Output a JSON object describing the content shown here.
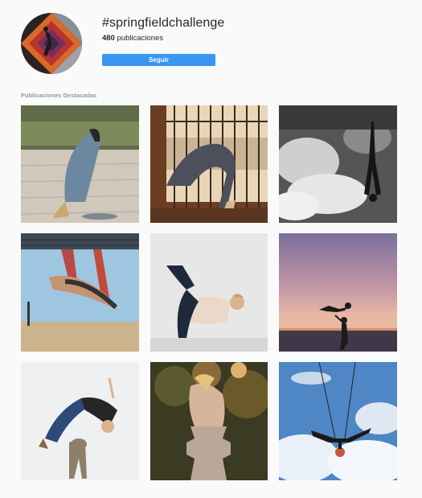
{
  "header": {
    "hashtag": "#springfieldchallenge",
    "post_count": "480",
    "post_count_suffix": " publicaciones",
    "follow_label": "Seguir"
  },
  "top_posts": {
    "label": "Publicaciones Destacadas"
  },
  "colors": {
    "accent": "#3897f0",
    "background": "#fafafa"
  }
}
